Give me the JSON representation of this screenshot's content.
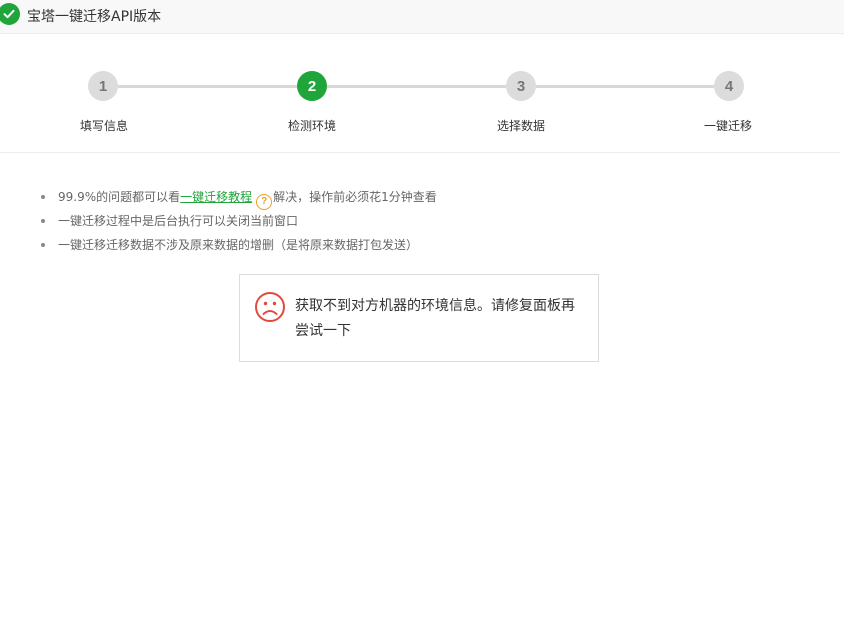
{
  "window": {
    "title": "宝塔一键迁移API版本",
    "icon": "check-circle-icon",
    "accent_color": "#20a53a"
  },
  "steps": [
    {
      "number": "1",
      "label": "填写信息",
      "active": false
    },
    {
      "number": "2",
      "label": "检测环境",
      "active": true
    },
    {
      "number": "3",
      "label": "选择数据",
      "active": false
    },
    {
      "number": "4",
      "label": "一键迁移",
      "active": false
    }
  ],
  "tips": {
    "item1_before": "99.9%的问题都可以看",
    "item1_link": "一键迁移教程",
    "item1_help_icon": "?",
    "item1_after": "解决，操作前必须花1分钟查看",
    "item2": "一键迁移过程中是后台执行可以关闭当前窗口",
    "item3": "一键迁移迁移数据不涉及原来数据的增删（是将原来数据打包发送）"
  },
  "error": {
    "icon": "sad-face-icon",
    "icon_color": "#e4493d",
    "message": "获取不到对方机器的环境信息。请修复面板再尝试一下"
  }
}
